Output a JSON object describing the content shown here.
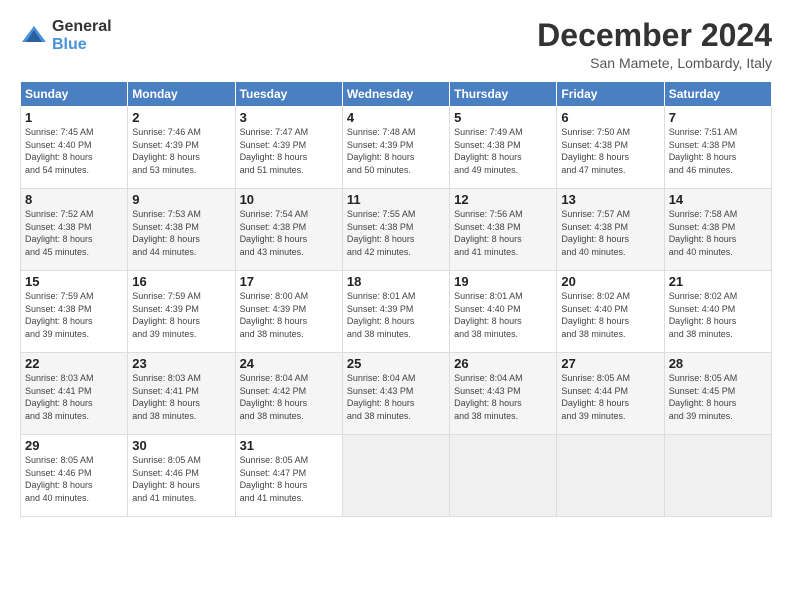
{
  "logo": {
    "general": "General",
    "blue": "Blue"
  },
  "title": "December 2024",
  "location": "San Mamete, Lombardy, Italy",
  "headers": [
    "Sunday",
    "Monday",
    "Tuesday",
    "Wednesday",
    "Thursday",
    "Friday",
    "Saturday"
  ],
  "weeks": [
    [
      {
        "day": "1",
        "sunrise": "7:45 AM",
        "sunset": "4:40 PM",
        "daylight": "8 hours and 54 minutes."
      },
      {
        "day": "2",
        "sunrise": "7:46 AM",
        "sunset": "4:39 PM",
        "daylight": "8 hours and 53 minutes."
      },
      {
        "day": "3",
        "sunrise": "7:47 AM",
        "sunset": "4:39 PM",
        "daylight": "8 hours and 51 minutes."
      },
      {
        "day": "4",
        "sunrise": "7:48 AM",
        "sunset": "4:39 PM",
        "daylight": "8 hours and 50 minutes."
      },
      {
        "day": "5",
        "sunrise": "7:49 AM",
        "sunset": "4:38 PM",
        "daylight": "8 hours and 49 minutes."
      },
      {
        "day": "6",
        "sunrise": "7:50 AM",
        "sunset": "4:38 PM",
        "daylight": "8 hours and 47 minutes."
      },
      {
        "day": "7",
        "sunrise": "7:51 AM",
        "sunset": "4:38 PM",
        "daylight": "8 hours and 46 minutes."
      }
    ],
    [
      {
        "day": "8",
        "sunrise": "7:52 AM",
        "sunset": "4:38 PM",
        "daylight": "8 hours and 45 minutes."
      },
      {
        "day": "9",
        "sunrise": "7:53 AM",
        "sunset": "4:38 PM",
        "daylight": "8 hours and 44 minutes."
      },
      {
        "day": "10",
        "sunrise": "7:54 AM",
        "sunset": "4:38 PM",
        "daylight": "8 hours and 43 minutes."
      },
      {
        "day": "11",
        "sunrise": "7:55 AM",
        "sunset": "4:38 PM",
        "daylight": "8 hours and 42 minutes."
      },
      {
        "day": "12",
        "sunrise": "7:56 AM",
        "sunset": "4:38 PM",
        "daylight": "8 hours and 41 minutes."
      },
      {
        "day": "13",
        "sunrise": "7:57 AM",
        "sunset": "4:38 PM",
        "daylight": "8 hours and 40 minutes."
      },
      {
        "day": "14",
        "sunrise": "7:58 AM",
        "sunset": "4:38 PM",
        "daylight": "8 hours and 40 minutes."
      }
    ],
    [
      {
        "day": "15",
        "sunrise": "7:59 AM",
        "sunset": "4:38 PM",
        "daylight": "8 hours and 39 minutes."
      },
      {
        "day": "16",
        "sunrise": "7:59 AM",
        "sunset": "4:39 PM",
        "daylight": "8 hours and 39 minutes."
      },
      {
        "day": "17",
        "sunrise": "8:00 AM",
        "sunset": "4:39 PM",
        "daylight": "8 hours and 38 minutes."
      },
      {
        "day": "18",
        "sunrise": "8:01 AM",
        "sunset": "4:39 PM",
        "daylight": "8 hours and 38 minutes."
      },
      {
        "day": "19",
        "sunrise": "8:01 AM",
        "sunset": "4:40 PM",
        "daylight": "8 hours and 38 minutes."
      },
      {
        "day": "20",
        "sunrise": "8:02 AM",
        "sunset": "4:40 PM",
        "daylight": "8 hours and 38 minutes."
      },
      {
        "day": "21",
        "sunrise": "8:02 AM",
        "sunset": "4:40 PM",
        "daylight": "8 hours and 38 minutes."
      }
    ],
    [
      {
        "day": "22",
        "sunrise": "8:03 AM",
        "sunset": "4:41 PM",
        "daylight": "8 hours and 38 minutes."
      },
      {
        "day": "23",
        "sunrise": "8:03 AM",
        "sunset": "4:41 PM",
        "daylight": "8 hours and 38 minutes."
      },
      {
        "day": "24",
        "sunrise": "8:04 AM",
        "sunset": "4:42 PM",
        "daylight": "8 hours and 38 minutes."
      },
      {
        "day": "25",
        "sunrise": "8:04 AM",
        "sunset": "4:43 PM",
        "daylight": "8 hours and 38 minutes."
      },
      {
        "day": "26",
        "sunrise": "8:04 AM",
        "sunset": "4:43 PM",
        "daylight": "8 hours and 38 minutes."
      },
      {
        "day": "27",
        "sunrise": "8:05 AM",
        "sunset": "4:44 PM",
        "daylight": "8 hours and 39 minutes."
      },
      {
        "day": "28",
        "sunrise": "8:05 AM",
        "sunset": "4:45 PM",
        "daylight": "8 hours and 39 minutes."
      }
    ],
    [
      {
        "day": "29",
        "sunrise": "8:05 AM",
        "sunset": "4:46 PM",
        "daylight": "8 hours and 40 minutes."
      },
      {
        "day": "30",
        "sunrise": "8:05 AM",
        "sunset": "4:46 PM",
        "daylight": "8 hours and 41 minutes."
      },
      {
        "day": "31",
        "sunrise": "8:05 AM",
        "sunset": "4:47 PM",
        "daylight": "8 hours and 41 minutes."
      },
      null,
      null,
      null,
      null
    ]
  ]
}
